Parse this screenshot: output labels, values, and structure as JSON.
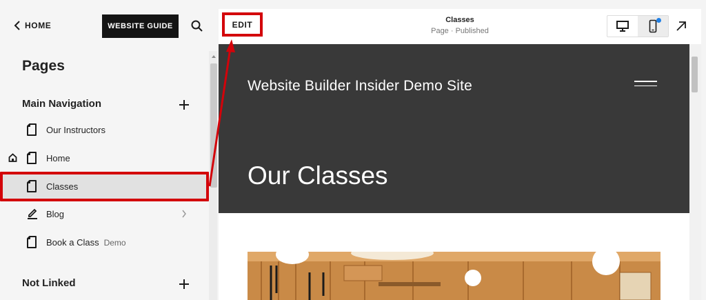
{
  "topbar": {
    "back_label": "HOME",
    "guide_label": "WEBSITE GUIDE"
  },
  "sidebar": {
    "title": "Pages",
    "main_nav_title": "Main Navigation",
    "items": [
      {
        "label": "Our Instructors",
        "tag": ""
      },
      {
        "label": "Home",
        "tag": ""
      },
      {
        "label": "Classes",
        "tag": ""
      },
      {
        "label": "Blog",
        "tag": ""
      },
      {
        "label": "Book a Class",
        "tag": "Demo"
      }
    ],
    "not_linked_title": "Not Linked"
  },
  "preview": {
    "edit_label": "EDIT",
    "page_name": "Classes",
    "page_status": "Page · Published",
    "site_title": "Website Builder Insider Demo Site",
    "hero_heading": "Our Classes"
  },
  "colors": {
    "highlight": "#d3030a",
    "hero_bg": "#393939",
    "notify_dot": "#1f7fe5"
  },
  "icons": [
    "chevron-left-icon",
    "search-icon",
    "plus-icon",
    "page-icon",
    "home-icon",
    "blog-edit-icon",
    "chevron-right-icon",
    "desktop-icon",
    "mobile-icon",
    "arrow-up-right-icon",
    "hamburger-menu-icon"
  ]
}
